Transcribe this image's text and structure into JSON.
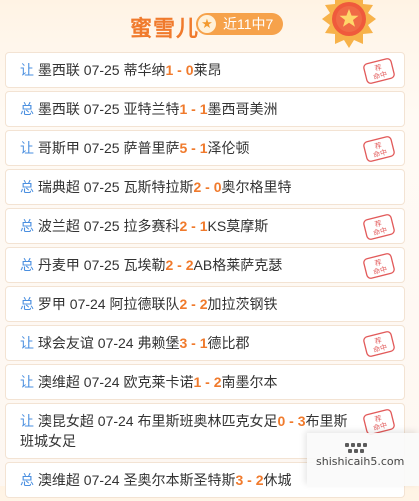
{
  "header": {
    "title": "蜜雪儿",
    "badge": "近11中7"
  },
  "stamp_text": [
    "荐",
    "命中"
  ],
  "rows": [
    {
      "kind": "让",
      "league": "墨西联",
      "date": "07-25",
      "home": "蒂华纳",
      "home_score": "1",
      "sep": " - ",
      "away_score": "0",
      "away": "莱昂",
      "hit": true
    },
    {
      "kind": "总",
      "league": "墨西联",
      "date": "07-25",
      "home": "亚特兰特",
      "home_score": "1",
      "sep": " - ",
      "away_score": "1",
      "away": "墨西哥美洲",
      "hit": false
    },
    {
      "kind": "让",
      "league": "哥斯甲",
      "date": "07-25",
      "home": "萨普里萨",
      "home_score": "5",
      "sep": " - ",
      "away_score": "1",
      "away": "泽伦顿",
      "hit": true
    },
    {
      "kind": "总",
      "league": "瑞典超",
      "date": "07-25",
      "home": "瓦斯特拉斯",
      "home_score": "2",
      "sep": " - ",
      "away_score": "0",
      "away": "奥尔格里特",
      "hit": false
    },
    {
      "kind": "总",
      "league": "波兰超",
      "date": "07-25",
      "home": "拉多赛科",
      "home_score": "2",
      "sep": " - ",
      "away_score": "1",
      "away": "KS莫摩斯",
      "hit": true
    },
    {
      "kind": "总",
      "league": "丹麦甲",
      "date": "07-25",
      "home": "瓦埃勒",
      "home_score": "2",
      "sep": " - ",
      "away_score": "2",
      "away": "AB格莱萨克瑟",
      "hit": true
    },
    {
      "kind": "总",
      "league": "罗甲",
      "date": "07-24",
      "home": "阿拉德联队",
      "home_score": "2",
      "sep": " - ",
      "away_score": "2",
      "away": "加拉茨钢铁",
      "hit": false
    },
    {
      "kind": "让",
      "league": "球会友谊",
      "date": "07-24",
      "home": "弗赖堡",
      "home_score": "3",
      "sep": " - ",
      "away_score": "1",
      "away": "德比郡",
      "hit": true
    },
    {
      "kind": "让",
      "league": "澳维超",
      "date": "07-24",
      "home": "欧克莱卡诺",
      "home_score": "1",
      "sep": " - ",
      "away_score": "2",
      "away": "南墨尔本",
      "hit": false
    },
    {
      "kind": "让",
      "league": "澳昆女超",
      "date": "07-24",
      "home": "布里斯班奥林匹克女足",
      "home_score": "0",
      "sep": " - ",
      "away_score": "3",
      "away": "布里斯班城女足",
      "hit": true
    },
    {
      "kind": "总",
      "league": "澳维超",
      "date": "07-24",
      "home": "圣奥尔本斯圣特斯",
      "home_score": "3",
      "sep": " - ",
      "away_score": "2",
      "away": "休城",
      "hit": false
    }
  ],
  "watermark": {
    "text": "shishicaih5.com"
  },
  "colors": {
    "accent": "#f07a2c",
    "kind_blue": "#4a8fe0",
    "stamp_red": "#e25a5a",
    "badge_bg": "#f6a24b"
  }
}
